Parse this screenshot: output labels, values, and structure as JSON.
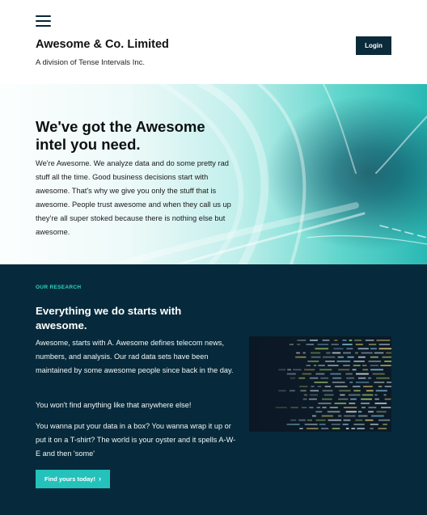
{
  "header": {
    "menu_icon": "hamburger-menu-icon",
    "brand_title": "Awesome & Co. Limited",
    "brand_subtitle": "A division of Tense Intervals Inc.",
    "login_label": "Login"
  },
  "hero": {
    "title": "We've got the Awesome intel you need.",
    "text": "We're Awesome. We analyze data and do some pretty rad stuff all the time. Good business decisions start with awesome. That's why we give you only the stuff that is awesome. People trust awesome and when they call us up they're all super stoked because there is nothing else but awesome."
  },
  "research": {
    "eyebrow": "OUR RESEARCH",
    "title": "Everything we do starts with awesome.",
    "paragraph_1": "Awesome, starts with A. Awesome defines telecom news, numbers, and analysis. Our rad data sets have been maintained by some awesome people since back in the day.",
    "paragraph_2": "You won't find anything like that anywhere else!",
    "paragraph_3": "You wanna put your data in a box? You wanna wrap it up or put it on a T-shirt? The world is your oyster and it spells A-W-E and then 'some'",
    "cta_label": "Find yours today!",
    "cta_icon": "chevron-right-icon"
  },
  "colors": {
    "navy": "#062a3b",
    "teal_accent": "#2fd3c4",
    "button_teal": "#24c2bb",
    "login_bg": "#0b2a3a"
  }
}
